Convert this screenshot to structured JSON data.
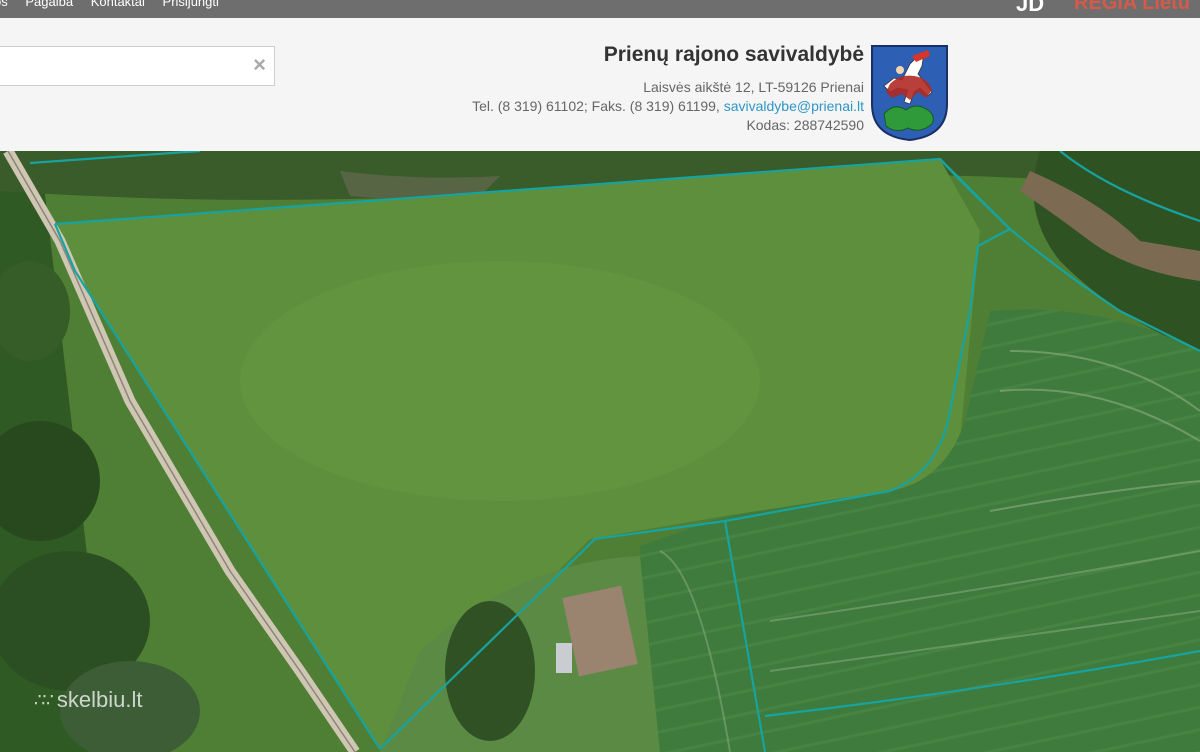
{
  "topbar": {
    "nav": [
      "os",
      "Pagalba",
      "Kontaktai",
      "Prisijungti"
    ],
    "logo_jd": "JD",
    "logo_regia": "REGIA Lietu"
  },
  "search": {
    "value": "",
    "placeholder": "",
    "clear_icon": "×"
  },
  "municipality": {
    "name": "Prienų rajono savivaldybė",
    "address": "Laisvės aikštė 12, LT-59126 Prienai",
    "phone_fax": "Tel. (8 319) 61102; Faks. (8 319) 61199,",
    "email": "savivaldybe@prienai.lt",
    "code": "Kodas: 288742590",
    "crest_icon": "coat-of-arms-icon"
  },
  "map": {
    "parcel_line_color": "#17a3a0",
    "watermark": "skelbiu.lt"
  }
}
